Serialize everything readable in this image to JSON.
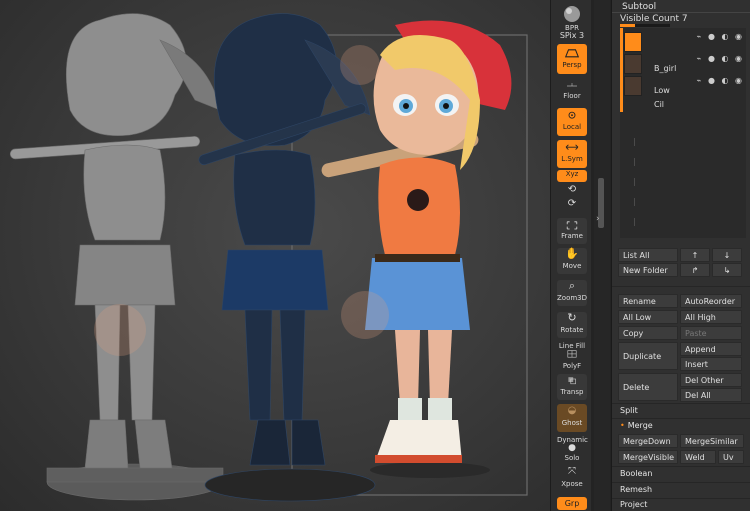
{
  "toolbar": {
    "bpr": "BPR",
    "spix": "SPix 3",
    "persp": "Persp",
    "floor": "Floor",
    "local": "Local",
    "lsym": "L.Sym",
    "xyz": "Xyz",
    "frame": "Frame",
    "move": "Move",
    "zoom3d": "Zoom3D",
    "rotate": "Rotate",
    "linefill": "Line Fill",
    "polyf": "PolyF",
    "transp": "Transp",
    "ghost": "Ghost",
    "dynamic": "Dynamic",
    "solo": "Solo",
    "xpose": "Xpose",
    "grp": "Grp"
  },
  "subtool": {
    "title": "Subtool",
    "visible_count": "Visible Count 7",
    "items": [
      {
        "name": ""
      },
      {
        "name": "B_girl"
      },
      {
        "name": "Low"
      },
      {
        "name": "Cil"
      }
    ],
    "list_all": "List All",
    "new_folder": "New Folder",
    "rename": "Rename",
    "auto_reorder": "AutoReorder",
    "all_low": "All Low",
    "all_high": "All High",
    "copy": "Copy",
    "paste": "Paste",
    "duplicate": "Duplicate",
    "append": "Append",
    "insert": "Insert",
    "delete": "Delete",
    "del_other": "Del Other",
    "del_all": "Del All",
    "split": "Split",
    "merge": "Merge",
    "merge_down": "MergeDown",
    "merge_similar": "MergeSimilar",
    "merge_visible": "MergeVisible",
    "weld": "Weld",
    "uv": "Uv",
    "boolean": "Boolean",
    "remesh": "Remesh",
    "project": "Project"
  },
  "colors": {
    "accent": "#ff8c1a",
    "panel": "#303030",
    "viewport": "#3a3a3a"
  }
}
